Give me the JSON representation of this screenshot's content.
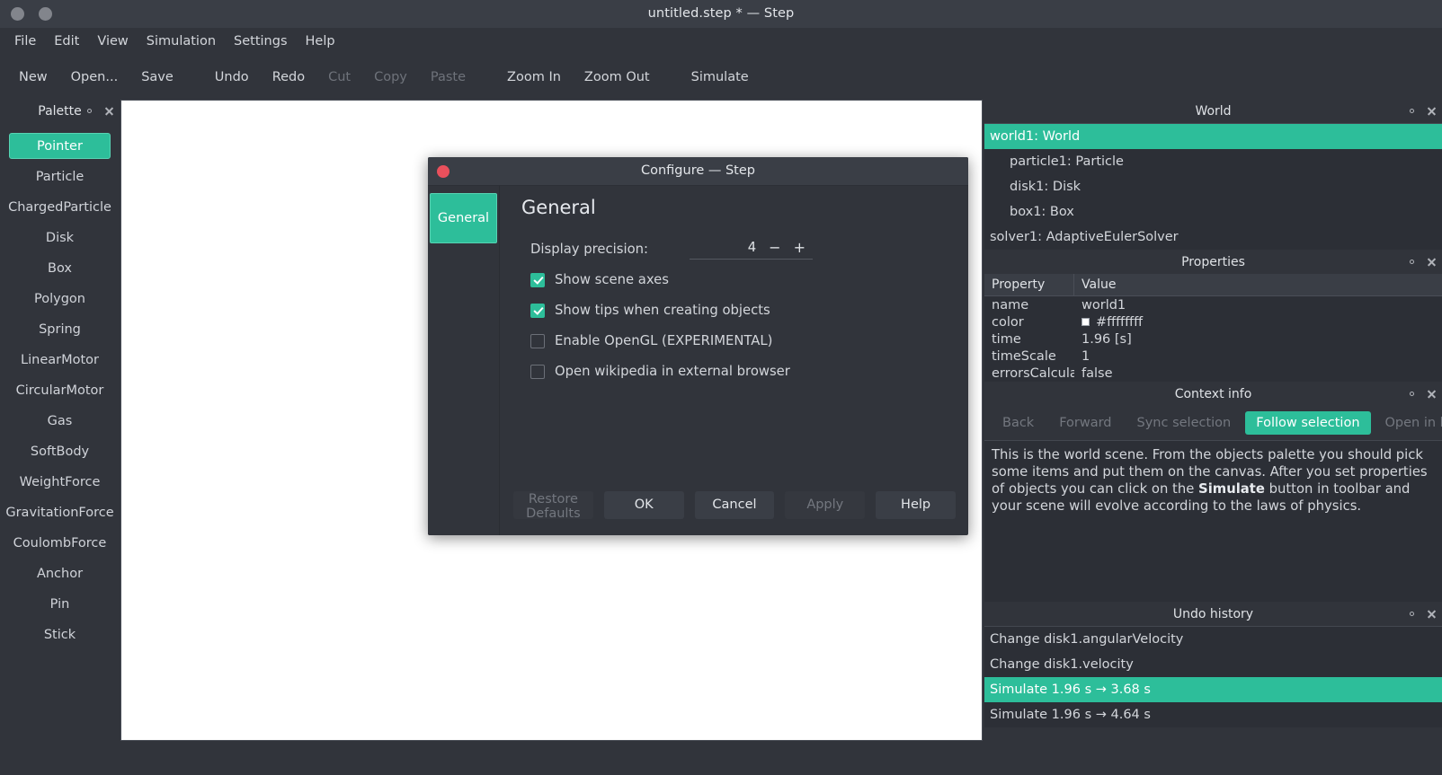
{
  "window": {
    "title": "untitled.step * — Step",
    "controls": [
      "minimize",
      "maximize"
    ]
  },
  "menubar": {
    "items": [
      {
        "label": "File"
      },
      {
        "label": "Edit"
      },
      {
        "label": "View"
      },
      {
        "label": "Simulation"
      },
      {
        "label": "Settings"
      },
      {
        "label": "Help"
      }
    ]
  },
  "toolbar": {
    "items": [
      {
        "label": "New",
        "enabled": true
      },
      {
        "label": "Open...",
        "enabled": true
      },
      {
        "label": "Save",
        "enabled": true
      },
      {
        "label": "Undo",
        "enabled": true
      },
      {
        "label": "Redo",
        "enabled": true
      },
      {
        "label": "Cut",
        "enabled": false
      },
      {
        "label": "Copy",
        "enabled": false
      },
      {
        "label": "Paste",
        "enabled": false
      },
      {
        "label": "Zoom In",
        "enabled": true
      },
      {
        "label": "Zoom Out",
        "enabled": true
      },
      {
        "label": "Simulate",
        "enabled": true
      }
    ]
  },
  "palette": {
    "title": "Palette",
    "items": [
      {
        "label": "Pointer",
        "selected": true
      },
      {
        "label": "Particle",
        "selected": false
      },
      {
        "label": "ChargedParticle",
        "selected": false
      },
      {
        "label": "Disk",
        "selected": false
      },
      {
        "label": "Box",
        "selected": false
      },
      {
        "label": "Polygon",
        "selected": false
      },
      {
        "label": "Spring",
        "selected": false
      },
      {
        "label": "LinearMotor",
        "selected": false
      },
      {
        "label": "CircularMotor",
        "selected": false
      },
      {
        "label": "Gas",
        "selected": false
      },
      {
        "label": "SoftBody",
        "selected": false
      },
      {
        "label": "WeightForce",
        "selected": false
      },
      {
        "label": "GravitationForce",
        "selected": false
      },
      {
        "label": "CoulombForce",
        "selected": false
      },
      {
        "label": "Anchor",
        "selected": false
      },
      {
        "label": "Pin",
        "selected": false
      },
      {
        "label": "Stick",
        "selected": false
      }
    ]
  },
  "world_panel": {
    "title": "World",
    "items": [
      {
        "label": "world1: World",
        "indent": false,
        "selected": true
      },
      {
        "label": "particle1: Particle",
        "indent": true,
        "selected": false
      },
      {
        "label": "disk1: Disk",
        "indent": true,
        "selected": false
      },
      {
        "label": "box1: Box",
        "indent": true,
        "selected": false
      },
      {
        "label": "solver1: AdaptiveEulerSolver",
        "indent": false,
        "selected": false
      }
    ]
  },
  "properties_panel": {
    "title": "Properties",
    "columns": [
      "Property",
      "Value"
    ],
    "rows": [
      {
        "property": "name",
        "value": "world1",
        "swatch": false
      },
      {
        "property": "color",
        "value": "#ffffffff",
        "swatch": true,
        "swatch_color": "#ffffff"
      },
      {
        "property": "time",
        "value": "1.96 [s]",
        "swatch": false
      },
      {
        "property": "timeScale",
        "value": "1",
        "swatch": false
      },
      {
        "property": "errorsCalcula...",
        "value": "false",
        "swatch": false
      }
    ]
  },
  "context_panel": {
    "title": "Context info",
    "buttons": [
      {
        "label": "Back",
        "active": false
      },
      {
        "label": "Forward",
        "active": false
      },
      {
        "label": "Sync selection",
        "active": false
      },
      {
        "label": "Follow selection",
        "active": true
      },
      {
        "label": "Open in browser",
        "active": false
      }
    ],
    "text_before": "This is the world scene. From the objects palette you should pick some items and put them on the canvas. After you set properties of objects you can click on the ",
    "text_bold": "Simulate",
    "text_after": " button in toolbar and your scene will evolve according to the laws of physics."
  },
  "undo_panel": {
    "title": "Undo history",
    "items": [
      {
        "label": "Change disk1.angularVelocity",
        "selected": false
      },
      {
        "label": "Change disk1.velocity",
        "selected": false
      },
      {
        "label": "Simulate 1.96 s → 3.68 s",
        "selected": true
      },
      {
        "label": "Simulate 1.96 s → 4.64 s",
        "selected": false
      }
    ]
  },
  "dialog": {
    "title": "Configure — Step",
    "sidebar": [
      {
        "label": "General",
        "selected": true
      }
    ],
    "heading": "General",
    "precision": {
      "label": "Display precision:",
      "value": "4",
      "decrement": "−",
      "increment": "+"
    },
    "checkboxes": [
      {
        "label": "Show scene axes",
        "checked": true
      },
      {
        "label": "Show tips when creating objects",
        "checked": true
      },
      {
        "label": "Enable OpenGL (EXPERIMENTAL)",
        "checked": false
      },
      {
        "label": "Open wikipedia in external browser",
        "checked": false
      }
    ],
    "buttons": [
      {
        "label": "Restore Defaults",
        "enabled": false
      },
      {
        "label": "OK",
        "enabled": true
      },
      {
        "label": "Cancel",
        "enabled": true
      },
      {
        "label": "Apply",
        "enabled": false
      },
      {
        "label": "Help",
        "enabled": true
      }
    ]
  },
  "colors": {
    "accent": "#2dbe9a",
    "background": "#31343b",
    "panel": "#2c2f36",
    "titlebar": "#3a3e46",
    "text": "#d3d6db",
    "text_disabled": "#73777f",
    "close_red": "#e9505c",
    "canvas": "#ffffff"
  }
}
